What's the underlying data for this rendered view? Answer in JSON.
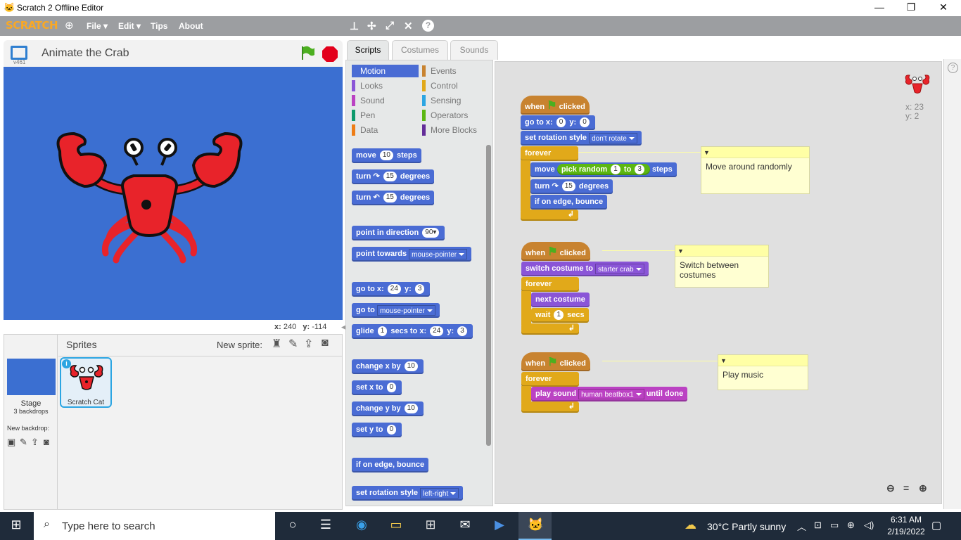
{
  "window": {
    "title": "Scratch 2 Offline Editor",
    "min": "—",
    "restore": "❐",
    "close": "✕"
  },
  "menubar": {
    "logo": "SCRATCH",
    "file": "File ▾",
    "edit": "Edit ▾",
    "tips": "Tips",
    "about": "About"
  },
  "stage": {
    "project_title": "Animate the Crab",
    "version": "v461",
    "coord_x_label": "x:",
    "coord_x": "240",
    "coord_y_label": "y:",
    "coord_y": "-114"
  },
  "tabs": {
    "scripts": "Scripts",
    "costumes": "Costumes",
    "sounds": "Sounds"
  },
  "categories": {
    "left": [
      "Motion",
      "Looks",
      "Sound",
      "Pen",
      "Data"
    ],
    "left_colors": [
      "#4a6cd4",
      "#8a55d7",
      "#bb42c3",
      "#0e9a6c",
      "#ee7d16"
    ],
    "right": [
      "Events",
      "Control",
      "Sensing",
      "Operators",
      "More Blocks"
    ],
    "right_colors": [
      "#c88330",
      "#e1a91a",
      "#2ca5e2",
      "#5cb712",
      "#632d99"
    ]
  },
  "palette": {
    "move": "move",
    "move_n": "10",
    "steps": "steps",
    "turn": "turn",
    "turn_n": "15",
    "degrees": "degrees",
    "point_dir": "point in direction",
    "dir_v": "90",
    "point_towards": "point towards",
    "towards_v": "mouse-pointer",
    "goto_xy": "go to x:",
    "gx": "24",
    "y_lbl": "y:",
    "gy": "3",
    "goto": "go to",
    "goto_v": "mouse-pointer",
    "glide": "glide",
    "glide_n": "1",
    "glide_mid": "secs to x:",
    "glide_x": "24",
    "glide_y": "3",
    "change_x": "change x by",
    "cx": "10",
    "set_x": "set x to",
    "sx": "0",
    "change_y": "change y by",
    "cy": "10",
    "set_y": "set y to",
    "sy": "0",
    "bounce": "if on edge, bounce",
    "set_rot": "set rotation style",
    "rot_v": "left-right"
  },
  "script1": {
    "when": "when",
    "clicked": "clicked",
    "goto": "go to x:",
    "x": "0",
    "y_lbl": "y:",
    "y": "0",
    "set_rot": "set rotation style",
    "rot_v": "don't rotate",
    "forever": "forever",
    "move": "move",
    "pick": "pick random",
    "r1": "1",
    "to": "to",
    "r2": "3",
    "steps": "steps",
    "turn": "turn",
    "turn_n": "15",
    "degrees": "degrees",
    "bounce": "if on edge, bounce",
    "comment": "Move around randomly"
  },
  "script2": {
    "when": "when",
    "clicked": "clicked",
    "switch": "switch costume to",
    "costume": "starter crab",
    "forever": "forever",
    "next": "next costume",
    "wait": "wait",
    "wait_n": "1",
    "secs": "secs",
    "comment": "Switch between costumes"
  },
  "script3": {
    "when": "when",
    "clicked": "clicked",
    "forever": "forever",
    "play": "play sound",
    "sound": "human beatbox1",
    "until": "until done",
    "comment": "Play music"
  },
  "sprite_info": {
    "x": "x: 23",
    "y": "y: 2"
  },
  "sprites": {
    "header": "Sprites",
    "new_sprite": "New sprite:",
    "stage_label": "Stage",
    "backdrops": "3 backdrops",
    "new_backdrop": "New backdrop:",
    "sprite1": "Scratch Cat"
  },
  "taskbar": {
    "search": "Type here to search",
    "weather": "30°C  Partly sunny",
    "time": "6:31 AM",
    "date": "2/19/2022"
  }
}
